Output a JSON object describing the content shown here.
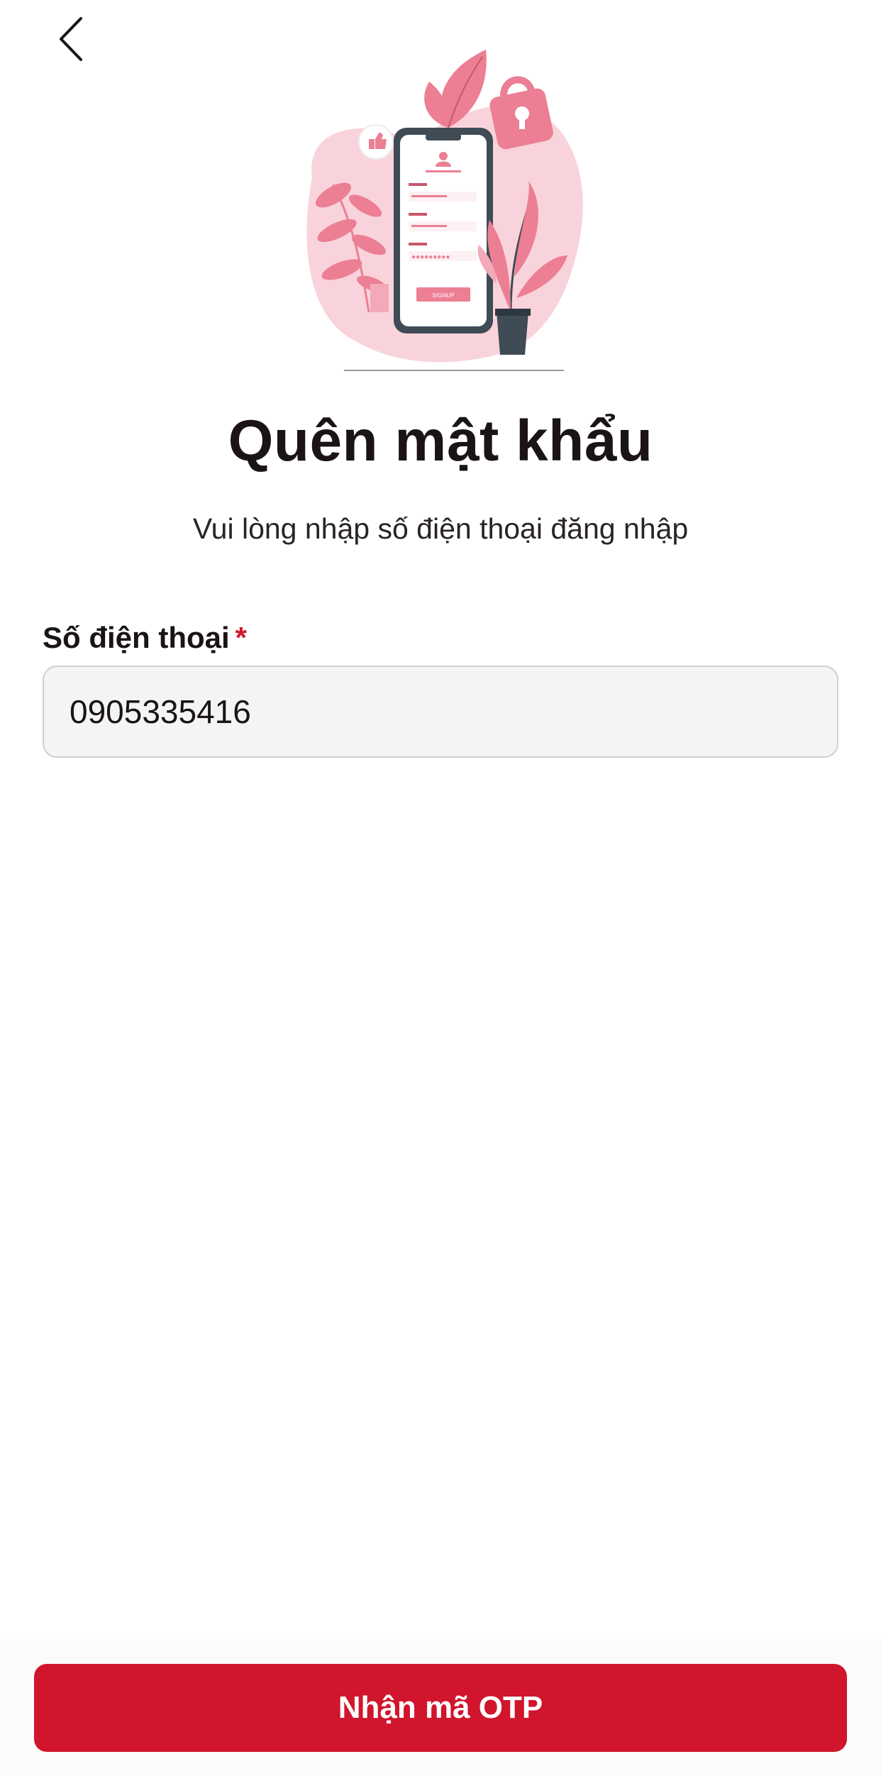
{
  "header": {
    "back_icon": "chevron-left-icon"
  },
  "illustration": {
    "icon": "phone-signup-illustration",
    "button_text": "SIGNUP"
  },
  "page": {
    "title": "Quên mật khẩu",
    "subtitle": "Vui lòng nhập số điện thoại đăng nhập"
  },
  "form": {
    "phone_label": "Số điện thoại",
    "required_mark": "*",
    "phone_value": "0905335416"
  },
  "footer": {
    "submit_label": "Nhận mã OTP"
  },
  "colors": {
    "accent": "#d0152c",
    "illustration_pink": "#ec7f93",
    "illustration_blob": "#f9d3db",
    "illustration_dark": "#3f4b55"
  }
}
